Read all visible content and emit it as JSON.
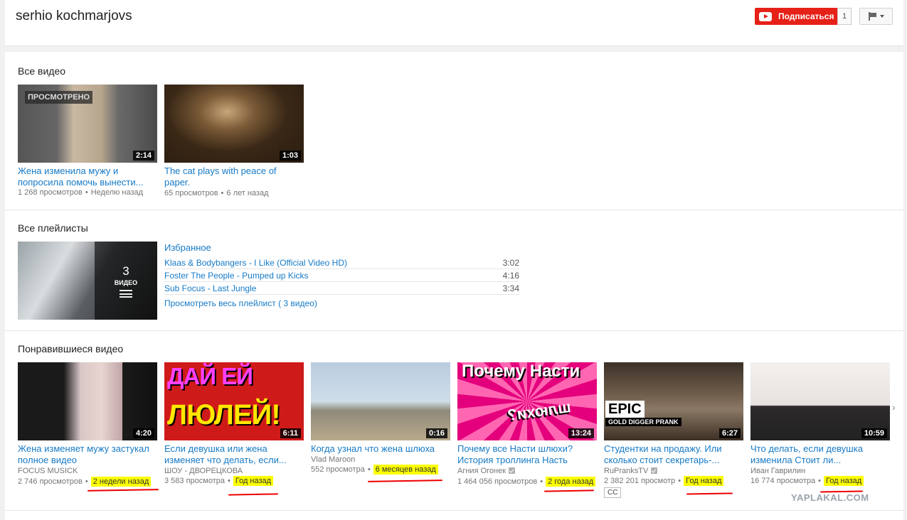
{
  "header": {
    "channel_name": "serhio kochmarjovs",
    "subscribe_label": "Подписаться",
    "subscriber_count": "1",
    "accent_color": "#e62117"
  },
  "all_videos": {
    "title": "Все видео",
    "items": [
      {
        "title": "Жена изменила мужу и попросила помочь вынести...",
        "views": "1 268 просмотров",
        "age": "Неделю назад",
        "duration": "2:14",
        "badge": "ПРОСМОТРЕНО"
      },
      {
        "title": "The cat plays with peace of paper.",
        "views": "65 просмотров",
        "age": "6 лет назад",
        "duration": "1:03"
      }
    ]
  },
  "playlists": {
    "title": "Все плейлисты",
    "name": "Избранное",
    "count": "3",
    "count_word": "ВИДЕО",
    "items": [
      {
        "title": "Klaas & Bodybangers - I Like (Official Video HD)",
        "duration": "3:02"
      },
      {
        "title": "Foster The People - Pumped up Kicks",
        "duration": "4:16"
      },
      {
        "title": "Sub Focus - Last Jungle",
        "duration": "3:34"
      }
    ],
    "view_all": "Просмотреть весь плейлист ( 3 видео)"
  },
  "liked": {
    "title": "Понравившиеся видео",
    "items": [
      {
        "title": "Жена изменяет мужу застукал полное видео",
        "channel": "FOCUS MUSICK",
        "views": "2 746 просмотров",
        "age": "2 недели назад",
        "duration": "4:20"
      },
      {
        "title": "Если девушка или жена изменяет что делать, если...",
        "channel": "ШОУ - ДВОРЕЦКОВА",
        "views": "3 583 просмотра",
        "age": "Год назад",
        "duration": "6:11",
        "thumb_text_1": "ДАЙ ЕЙ",
        "thumb_text_2": "ЛЮЛЕЙ!"
      },
      {
        "title": "Когда узнал что жена шлюха",
        "channel": "Vlad Maroon",
        "views": "552 просмотра",
        "age": "6 месяцев назад",
        "duration": "0:16"
      },
      {
        "title": "Почему все Насти шлюхи? История троллинга Насть",
        "channel": "Агния Огонек",
        "views": "1 464 056 просмотров",
        "age": "2 года назад",
        "duration": "13:24",
        "thumb_text_1": "Почему Насти",
        "thumb_text_2": "шлюхи?"
      },
      {
        "title": "Студентки на продажу. Или сколько стоит секретарь-...",
        "channel": "RuPranksTV",
        "views": "2 382 201 просмотр",
        "age": "Год назад",
        "duration": "6:27",
        "cc": "CC",
        "thumb_text_1": "EPIC",
        "thumb_text_2": "GOLD DIGGER PRANK"
      },
      {
        "title": "Что делать, если девушка изменила Стоит ли...",
        "channel": "Иван Гаврилин",
        "views": "16 774 просмотра",
        "age": "Год назад",
        "duration": "10:59"
      }
    ]
  },
  "watermark": "YAPLAKAL.COM",
  "highlight_color": "#fbff00",
  "link_color": "#167ac6"
}
